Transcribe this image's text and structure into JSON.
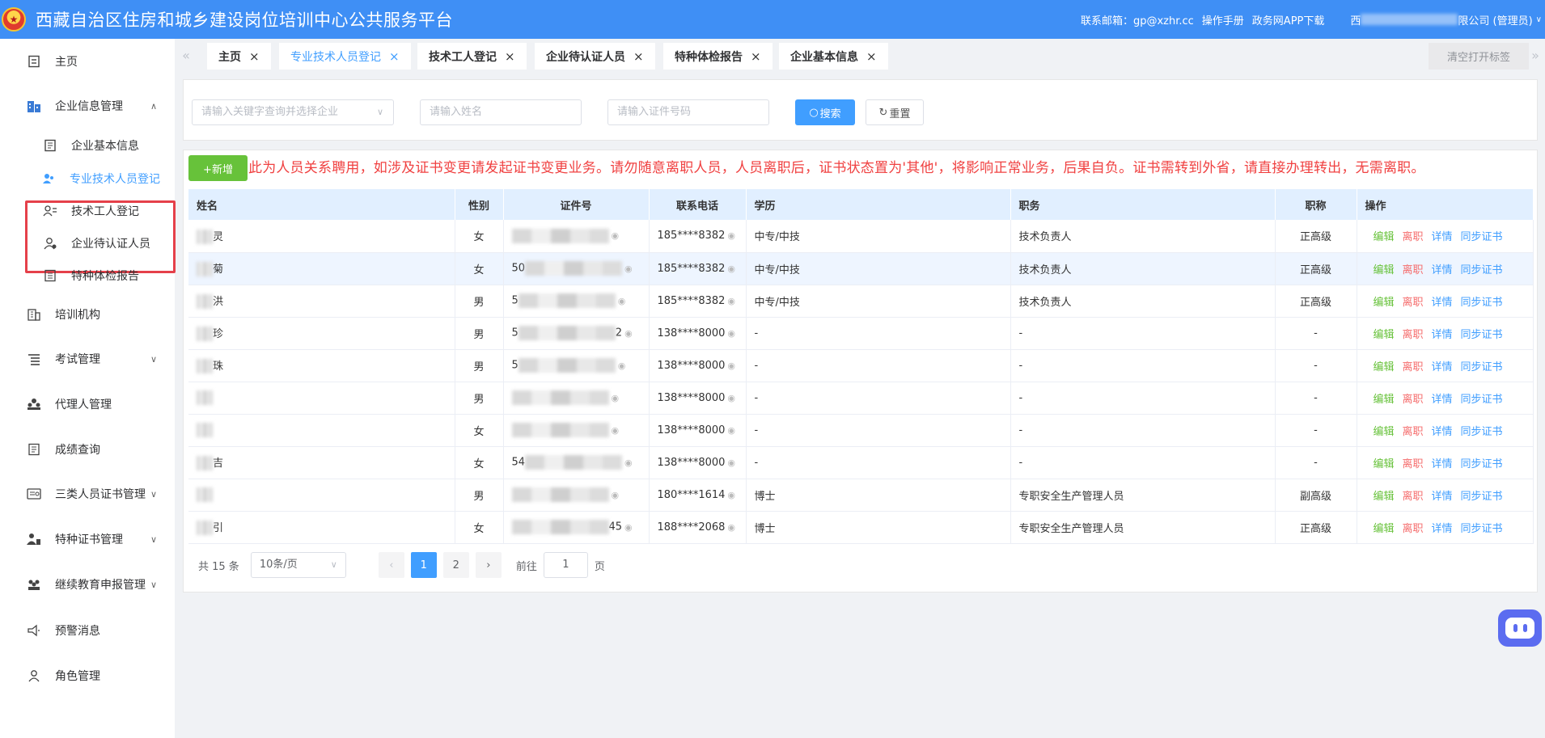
{
  "header": {
    "title": "西藏自治区住房和城乡建设岗位培训中心公共服务平台",
    "email": "联系邮箱：gp@xzhr.cc",
    "manual": "操作手册",
    "app_download": "政务网APP下载",
    "user_prefix": "西",
    "user_suffix": "限公司 (管理员)",
    "user_chevron": "chevron-down-icon"
  },
  "sidebar": {
    "items": [
      {
        "label": "主页",
        "icon": "home-icon"
      },
      {
        "label": "企业信息管理",
        "icon": "building-icon",
        "expanded": true
      },
      {
        "label": "企业基本信息",
        "icon": "document-icon"
      },
      {
        "label": "专业技术人员登记",
        "icon": "user-group-icon",
        "active": true
      },
      {
        "label": "技术工人登记",
        "icon": "user-list-icon"
      },
      {
        "label": "企业待认证人员",
        "icon": "user-check-icon"
      },
      {
        "label": "特种体检报告",
        "icon": "report-icon"
      },
      {
        "label": "培训机构",
        "icon": "institution-icon"
      },
      {
        "label": "考试管理",
        "icon": "list-icon"
      },
      {
        "label": "代理人管理",
        "icon": "agent-icon"
      },
      {
        "label": "成绩查询",
        "icon": "score-icon"
      },
      {
        "label": "三类人员证书管理",
        "icon": "certificate-icon"
      },
      {
        "label": "特种证书管理",
        "icon": "special-cert-icon"
      },
      {
        "label": "继续教育申报管理",
        "icon": "education-icon"
      },
      {
        "label": "预警消息",
        "icon": "megaphone-icon"
      },
      {
        "label": "角色管理",
        "icon": "role-icon"
      }
    ]
  },
  "tabs": {
    "items": [
      {
        "label": "主页"
      },
      {
        "label": "专业技术人员登记",
        "active": true
      },
      {
        "label": "技术工人登记"
      },
      {
        "label": "企业待认证人员"
      },
      {
        "label": "特种体检报告"
      },
      {
        "label": "企业基本信息"
      }
    ],
    "clear_label": "清空打开标签"
  },
  "search": {
    "company_placeholder": "请输入关键字查询并选择企业",
    "name_placeholder": "请输入姓名",
    "id_placeholder": "请输入证件号码",
    "search_label": "搜索",
    "reset_label": "重置"
  },
  "table": {
    "add_label": "+新增",
    "notice": "此为人员关系聘用，如涉及证书变更请发起证书变更业务。请勿随意离职人员，人员离职后，证书状态置为'其他'，将影响正常业务，后果自负。证书需转到外省，请直接办理转出，无需离职。",
    "columns": [
      "姓名",
      "性别",
      "证件号",
      "联系电话",
      "学历",
      "职务",
      "职称",
      "操作"
    ],
    "actions": {
      "edit": "编辑",
      "quit": "离职",
      "detail": "详情",
      "sync": "同步证书"
    },
    "rows": [
      {
        "name": "灵",
        "gender": "女",
        "id_prefix": "",
        "id_suffix": "",
        "phone": "185****8382",
        "edu": "中专/中技",
        "duty": "技术负责人",
        "title": "正高级"
      },
      {
        "name": "菊",
        "gender": "女",
        "id_prefix": "50",
        "id_suffix": "",
        "phone": "185****8382",
        "edu": "中专/中技",
        "duty": "技术负责人",
        "title": "正高级"
      },
      {
        "name": "洪",
        "gender": "男",
        "id_prefix": "5",
        "id_suffix": "",
        "phone": "185****8382",
        "edu": "中专/中技",
        "duty": "技术负责人",
        "title": "正高级"
      },
      {
        "name": "珍",
        "gender": "男",
        "id_prefix": "5",
        "id_suffix": "2",
        "phone": "138****8000",
        "edu": "-",
        "duty": "-",
        "title": "-"
      },
      {
        "name": "珠",
        "gender": "男",
        "id_prefix": "5",
        "id_suffix": "",
        "phone": "138****8000",
        "edu": "-",
        "duty": "-",
        "title": "-"
      },
      {
        "name": "",
        "gender": "男",
        "id_prefix": "",
        "id_suffix": "",
        "phone": "138****8000",
        "edu": "-",
        "duty": "-",
        "title": "-"
      },
      {
        "name": "",
        "gender": "女",
        "id_prefix": "",
        "id_suffix": "",
        "phone": "138****8000",
        "edu": "-",
        "duty": "-",
        "title": "-"
      },
      {
        "name": "吉",
        "gender": "女",
        "id_prefix": "54",
        "id_suffix": "",
        "phone": "138****8000",
        "edu": "-",
        "duty": "-",
        "title": "-"
      },
      {
        "name": "",
        "gender": "男",
        "id_prefix": "",
        "id_suffix": "",
        "phone": "180****1614",
        "edu": "博士",
        "duty": "专职安全生产管理人员",
        "title": "副高级"
      },
      {
        "name": "引",
        "gender": "女",
        "id_prefix": "",
        "id_suffix": "45",
        "phone": "188****2068",
        "edu": "博士",
        "duty": "专职安全生产管理人员",
        "title": "正高级"
      }
    ]
  },
  "pagination": {
    "total": "共 15 条",
    "page_size": "10条/页",
    "pages": [
      "1",
      "2"
    ],
    "current": "1",
    "goto_label": "前往",
    "goto_value": "1",
    "page_unit": "页"
  },
  "colors": {
    "primary": "#409eff",
    "header": "#3f8ff5",
    "notice": "#f04141",
    "success": "#67c23a",
    "danger": "#f56c6c"
  }
}
